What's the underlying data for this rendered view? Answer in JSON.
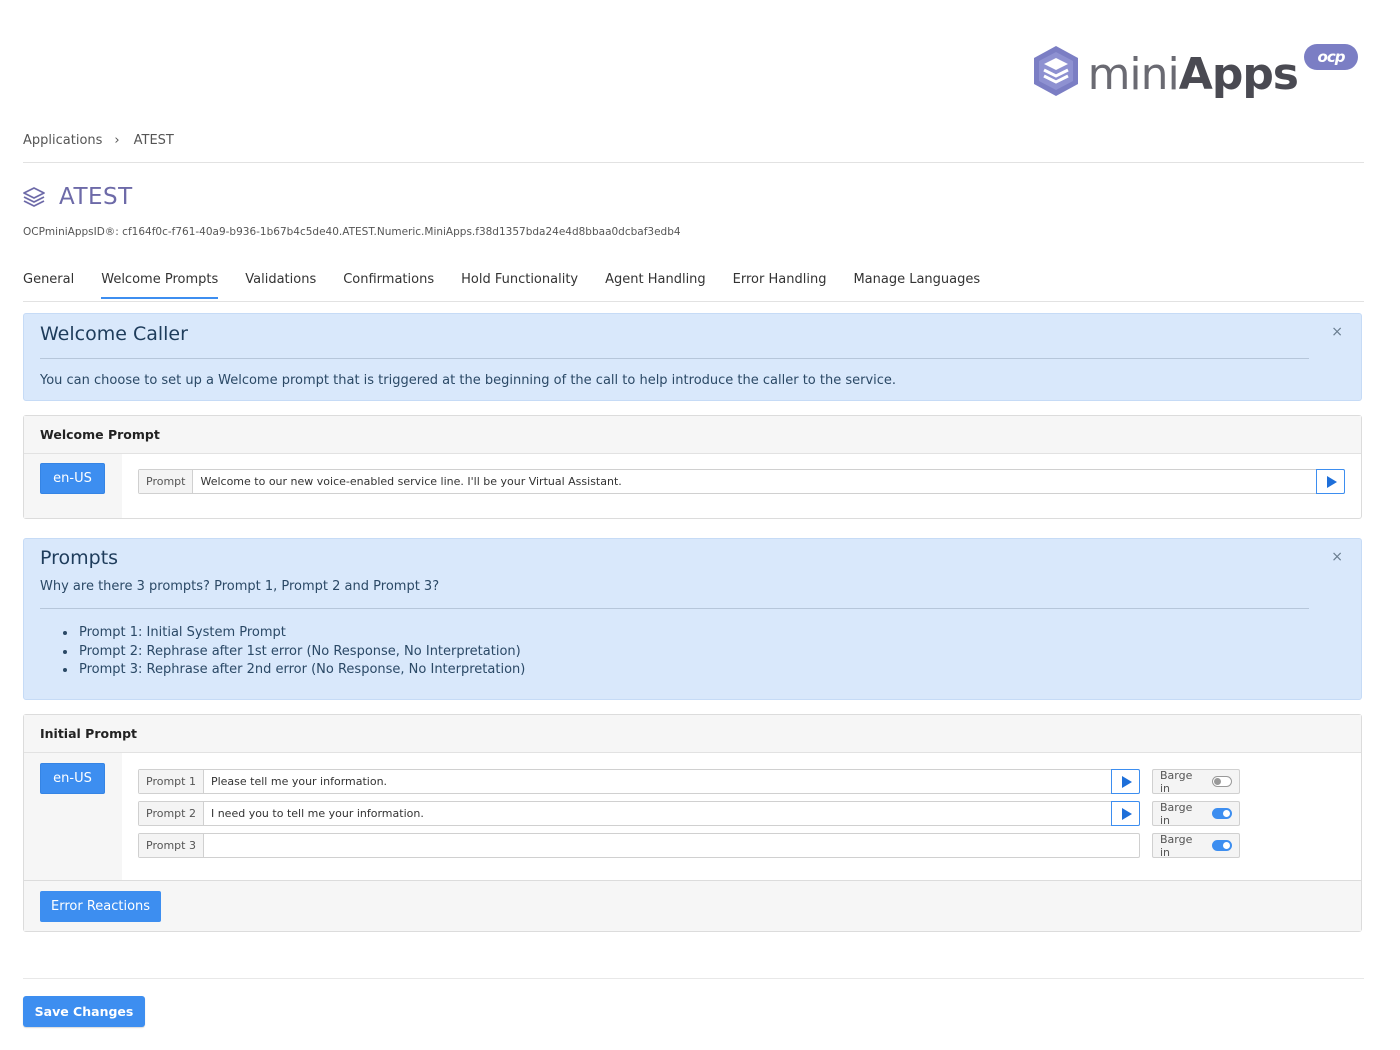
{
  "logo": {
    "text_light": "mini",
    "text_bold": "Apps",
    "badge": "ocp"
  },
  "breadcrumb": {
    "root": "Applications",
    "separator": "›",
    "current": "ATEST"
  },
  "page": {
    "title": "ATEST",
    "app_id": "OCPminiAppsID®: cf164f0c-f761-40a9-b936-1b67b4c5de40.ATEST.Numeric.MiniApps.f38d1357bda24e4d8bbaa0dcbaf3edb4"
  },
  "tabs": [
    {
      "label": "General"
    },
    {
      "label": "Welcome Prompts",
      "active": true
    },
    {
      "label": "Validations"
    },
    {
      "label": "Confirmations"
    },
    {
      "label": "Hold Functionality"
    },
    {
      "label": "Agent Handling"
    },
    {
      "label": "Error Handling"
    },
    {
      "label": "Manage Languages"
    }
  ],
  "welcome_info": {
    "title": "Welcome Caller",
    "close": "×",
    "text": "You can choose to set up a Welcome prompt that is triggered at the beginning of the call to help introduce the caller to the service."
  },
  "welcome_card": {
    "header": "Welcome Prompt",
    "language": "en-US",
    "prompt_label": "Prompt",
    "prompt_value": "Welcome to our new voice-enabled service line. I'll be your Virtual Assistant."
  },
  "prompts_info": {
    "title": "Prompts",
    "close": "×",
    "subtitle": "Why are there 3 prompts? Prompt 1, Prompt 2 and Prompt 3?",
    "items": [
      "Prompt 1: Initial System Prompt",
      "Prompt 2: Rephrase after 1st error (No Response, No Interpretation)",
      "Prompt 3: Rephrase after 2nd error (No Response, No Interpretation)"
    ]
  },
  "initial_card": {
    "header": "Initial Prompt",
    "language": "en-US",
    "prompts": [
      {
        "label": "Prompt 1",
        "value": "Please tell me your information.",
        "barge_label": "Barge in",
        "barge_on": false
      },
      {
        "label": "Prompt 2",
        "value": "I need you to tell me your information.",
        "barge_label": "Barge in",
        "barge_on": true
      },
      {
        "label": "Prompt 3",
        "value": "",
        "barge_label": "Barge in",
        "barge_on": true
      }
    ],
    "error_button": "Error Reactions"
  },
  "footer": {
    "save_label": "Save Changes"
  },
  "colors": {
    "accent": "#3d8ef0",
    "brand": "#6d6aa8",
    "info_bg": "#d9e8fb"
  }
}
